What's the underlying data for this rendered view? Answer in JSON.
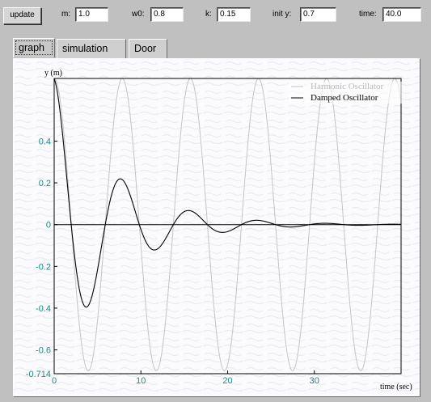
{
  "toolbar": {
    "update_label": "update",
    "m_label": "m:",
    "m_value": "1.0",
    "w0_label": "w0:",
    "w0_value": "0.8",
    "k_label": "k:",
    "k_value": "0.15",
    "inity_label": "init y:",
    "inity_value": "0.7",
    "time_label": "time:",
    "time_value": "40.0"
  },
  "tabs": [
    {
      "label": "graph",
      "active": true
    },
    {
      "label": "simulation",
      "active": false
    },
    {
      "label": "Door",
      "active": false
    }
  ],
  "chart_data": {
    "type": "line",
    "ylabel": "y (m)",
    "xlabel": "time (sec)",
    "xlim": [
      0,
      40
    ],
    "ylim": [
      -0.714,
      0.7
    ],
    "x_ticks": [
      "0",
      "10",
      "20",
      "30"
    ],
    "y_ticks": [
      "0.4",
      "0.2",
      "0",
      "-0.2",
      "-0.4",
      "-0.6",
      "-0.714"
    ],
    "legend": "top-right",
    "colors": {
      "harmonic": "#c4c4c4",
      "damped": "#000000",
      "axis": "#000000",
      "tick_label": "#1d8a8a",
      "label": "#7a5a10"
    },
    "series": [
      {
        "name": "Harmonic Oscillator",
        "model": "y = 0.7 cos(0.8 t)",
        "points_sampled_every": 0.25
      },
      {
        "name": "Damped Oscillator",
        "model": "y = 0.7 e^(-0.15 t) cos(0.8 t)",
        "points_sampled_every": 0.25
      }
    ]
  }
}
